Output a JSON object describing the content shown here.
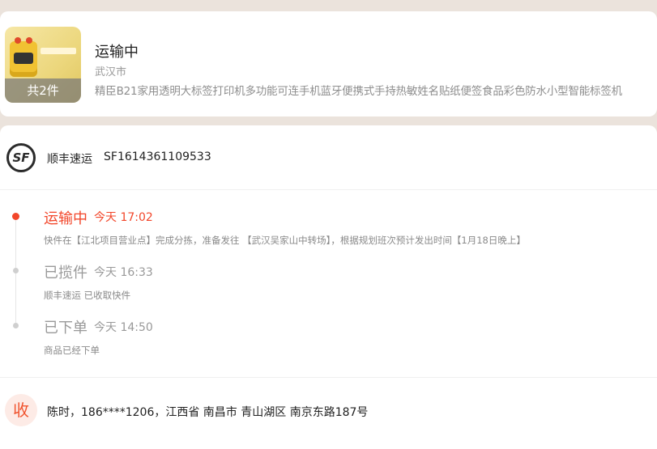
{
  "order": {
    "status": "运输中",
    "city": "武汉市",
    "product_title": "精臣B21家用透明大标签打印机多功能可连手机蓝牙便携式手持热敏姓名贴纸便签食品彩色防水小型智能标签机",
    "item_count": "共2件",
    "thumbnail_icon": "label-printer-product-image"
  },
  "shipping": {
    "carrier_logo": "SF",
    "carrier": "顺丰速运",
    "tracking_number": "SF1614361109533"
  },
  "timeline": [
    {
      "status": "运输中",
      "time": "今天 17:02",
      "desc": "快件在【江北项目营业点】完成分拣，准备发往 【武汉吴家山中转场】，根据规划班次预计发出时间【1月18日晚上】",
      "active": true
    },
    {
      "status": "已揽件",
      "time": "今天 16:33",
      "desc": "顺丰速运 已收取快件",
      "active": false
    },
    {
      "status": "已下单",
      "time": "今天 14:50",
      "desc": "商品已经下单",
      "active": false
    }
  ],
  "receiver": {
    "badge": "收",
    "address": "陈时，186****1206，江西省 南昌市 青山湖区 南京东路187号"
  },
  "colors": {
    "accent": "#f2462a",
    "background": "#ebe3dc"
  }
}
